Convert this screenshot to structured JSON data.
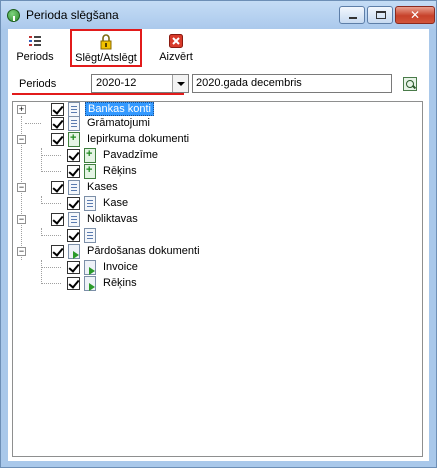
{
  "window": {
    "title": "Perioda slēgšana"
  },
  "toolbar": {
    "periods_label": "Periods",
    "close_open_label": "Slēgt/Atslēgt",
    "exit_label": "Aizvērt"
  },
  "period": {
    "label": "Periods",
    "selected": "2020-12",
    "description": "2020.gada decembris"
  },
  "tree": [
    {
      "label": "Bankas konti",
      "checked": true,
      "selected": true
    },
    {
      "label": "Grāmatojumi",
      "checked": true
    },
    {
      "label": "Iepirkuma dokumenti",
      "checked": true,
      "children": [
        {
          "label": "Pavadzīme",
          "checked": true
        },
        {
          "label": "Rēķins",
          "checked": true
        }
      ]
    },
    {
      "label": "Kases",
      "checked": true,
      "children": [
        {
          "label": "Kase",
          "checked": true
        }
      ]
    },
    {
      "label": "Noliktavas",
      "checked": true,
      "children": [
        {
          "label": "",
          "checked": true
        }
      ]
    },
    {
      "label": "Pārdošanas dokumenti",
      "checked": true,
      "children": [
        {
          "label": "Invoice",
          "checked": true
        },
        {
          "label": "Rēķins",
          "checked": true
        }
      ]
    }
  ],
  "icons": {
    "periods": "list-icon",
    "close_open": "lock-icon",
    "exit": "close-icon"
  }
}
